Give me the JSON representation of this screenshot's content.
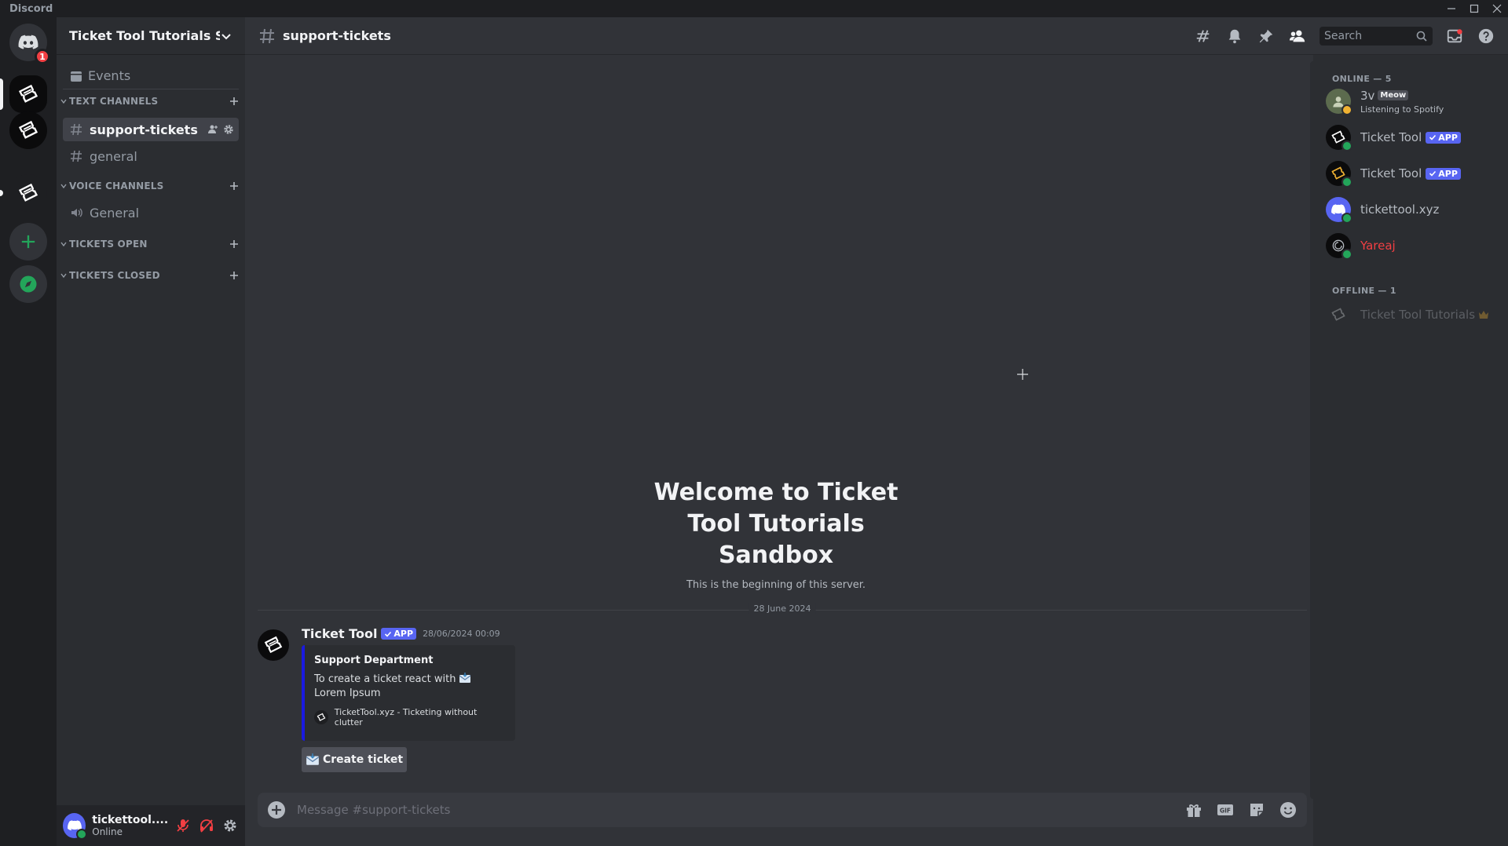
{
  "window": {
    "app_name": "Discord"
  },
  "guilds": {
    "home_badge": "1"
  },
  "sidebar": {
    "server_name": "Ticket Tool Tutorials San...",
    "events_label": "Events",
    "categories": [
      {
        "name": "TEXT CHANNELS"
      },
      {
        "name": "VOICE CHANNELS"
      },
      {
        "name": "TICKETS OPEN"
      },
      {
        "name": "TICKETS CLOSED"
      }
    ],
    "channels": [
      {
        "name": "support-tickets"
      },
      {
        "name": "general"
      },
      {
        "name": "General"
      }
    ]
  },
  "user_panel": {
    "username": "tickettool....",
    "status": "Online"
  },
  "header": {
    "channel": "support-tickets",
    "search_placeholder": "Search"
  },
  "welcome": {
    "title": "Welcome to Ticket Tool Tutorials Sandbox",
    "subtitle": "This is the beginning of this server."
  },
  "divider_date": "28 June 2024",
  "message": {
    "author": "Ticket Tool",
    "app_tag": "APP",
    "timestamp": "28/06/2024 00:09",
    "embed": {
      "title": "Support Department",
      "desc_line1": "To create a ticket react with",
      "desc_line2": "Lorem Ipsum",
      "footer": "TicketTool.xyz - Ticketing without clutter"
    },
    "button_label": "Create ticket"
  },
  "composer": {
    "placeholder": "Message #support-tickets"
  },
  "members": {
    "online_header": "ONLINE — 5",
    "offline_header": "OFFLINE — 1",
    "online": [
      {
        "name": "3v",
        "tag": "Meow",
        "activity": "Listening to Spotify"
      },
      {
        "name": "Ticket Tool",
        "tag": "APP"
      },
      {
        "name": "Ticket Tool",
        "tag": "APP"
      },
      {
        "name": "tickettool.xyz"
      },
      {
        "name": "Yareaj"
      }
    ],
    "offline": [
      {
        "name": "Ticket Tool Tutorials"
      }
    ]
  },
  "colors": {
    "accent": "#5865f2",
    "online": "#23a55a",
    "embed_bar": "#1a1ae0",
    "danger": "#f23f43"
  }
}
